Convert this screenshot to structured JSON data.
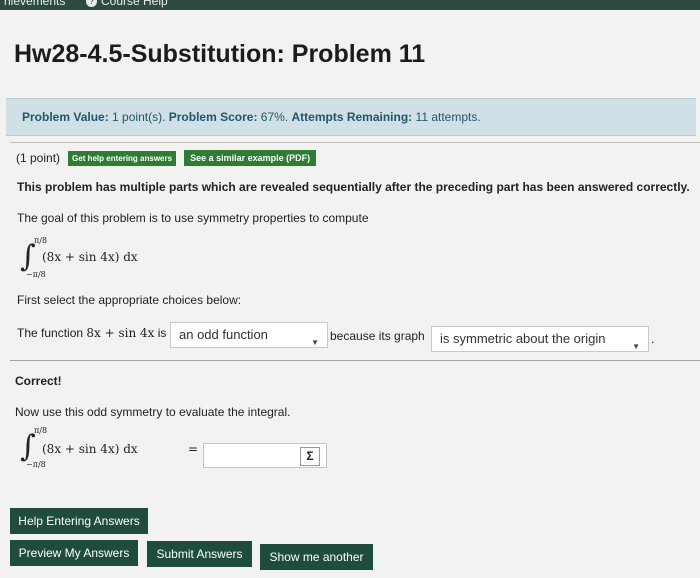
{
  "nav": {
    "achievements_label": "hievements",
    "course_help_label": "Course Help"
  },
  "page_title": "Hw28-4.5-Substitution: Problem 11",
  "info": {
    "value_label": "Problem Value:",
    "value_text": "1 point(s).",
    "score_label": "Problem Score:",
    "score_text": "67%.",
    "attempts_label": "Attempts Remaining:",
    "attempts_text": "11 attempts."
  },
  "problem": {
    "points": "(1 point)",
    "help_button": "Get help entering answers",
    "similar_button": "See a similar example (PDF)",
    "intro": "This problem has multiple parts which are revealed sequentially after the preceding part has been answered correctly.",
    "goal": "The goal of this problem is to use symmetry properties to compute",
    "integral_upper": "π/8",
    "integral_lower": "−π/8",
    "integrand": "(8x + sin 4x) dx",
    "select_prompt": "First select the appropriate choices below:",
    "function_prefix": "The function",
    "function_expr": "8x + sin 4x",
    "function_is": "is",
    "choice1_value": "an odd function",
    "because_text": "because its graph",
    "choice2_value": "is symmetric about the origin",
    "after_select": ".",
    "correct_label": "Correct!",
    "evaluate_prompt": "Now use this odd symmetry to evaluate the integral.",
    "equals": "=",
    "answer_value": "",
    "sigma": "Σ"
  },
  "buttons": {
    "help_entering": "Help Entering Answers",
    "preview": "Preview My Answers",
    "submit": "Submit Answers",
    "show_another": "Show me another"
  }
}
